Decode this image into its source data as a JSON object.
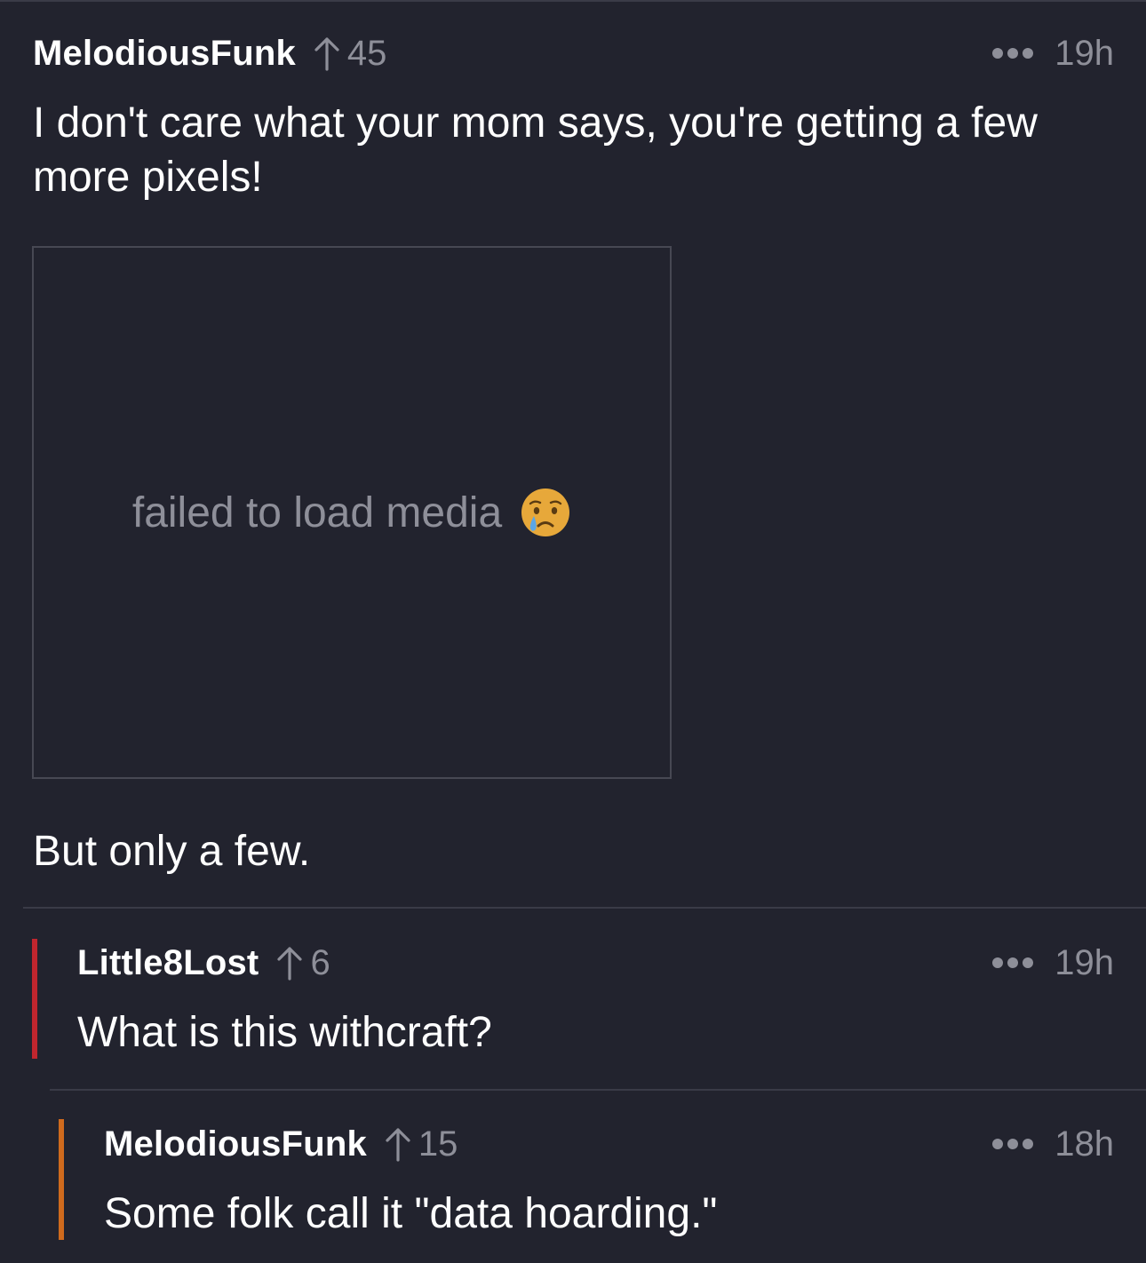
{
  "comments": [
    {
      "author": "MelodiousFunk",
      "score": "45",
      "age": "19h",
      "body_line1": "I don't care what your mom says, you're getting a few",
      "body_line2": "more pixels!",
      "media_error": "failed to load media",
      "media_error_icon": "crying-face-icon",
      "body_after": "But only a few."
    },
    {
      "author": "Little8Lost",
      "score": "6",
      "age": "19h",
      "body": "What is this withcraft?",
      "thread_color": "#c0262e"
    },
    {
      "author": "MelodiousFunk",
      "score": "15",
      "age": "18h",
      "body": "Some folk call it \"data hoarding.\"",
      "thread_color": "#cf6a1d"
    }
  ],
  "theme": {
    "background": "#22232e",
    "muted_text": "#8e8f99",
    "divider": "#3a3b47"
  }
}
